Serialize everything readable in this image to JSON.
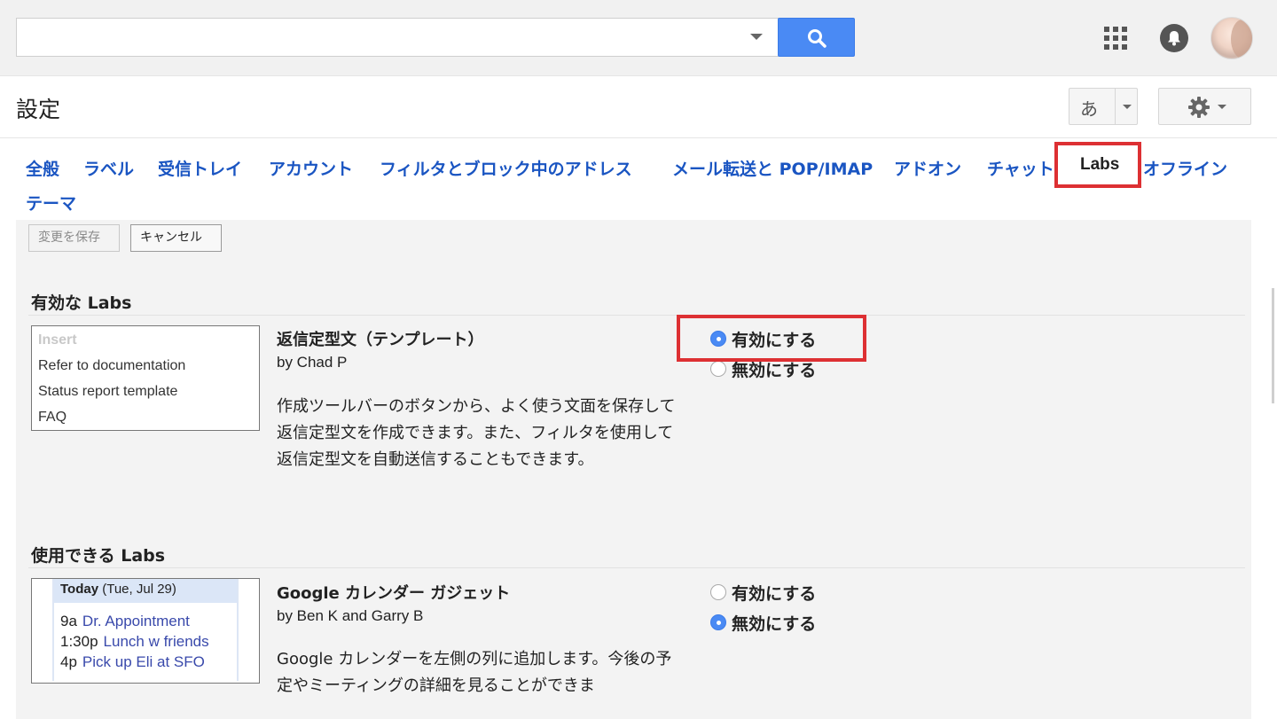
{
  "search": {
    "value": "",
    "placeholder": ""
  },
  "header": {
    "title": "設定",
    "ime_label": "あ"
  },
  "tabs": [
    {
      "label": "全般"
    },
    {
      "label": "ラベル"
    },
    {
      "label": "受信トレイ"
    },
    {
      "label": "アカウント"
    },
    {
      "label": "フィルタとブロック中のアドレス"
    },
    {
      "label": "メール転送と POP/IMAP"
    },
    {
      "label": "アドオン"
    },
    {
      "label": "チャット"
    },
    {
      "label": "Labs",
      "active": true
    },
    {
      "label": "オフライン"
    },
    {
      "label": "テーマ"
    }
  ],
  "actions": {
    "save_label": "変更を保存",
    "cancel_label": "キャンセル"
  },
  "enabled_labs": {
    "title": "有効な Labs",
    "items": [
      {
        "preview": [
          "Insert",
          "Refer to documentation",
          "Status report template",
          "FAQ"
        ],
        "title": "返信定型文（テンプレート）",
        "author": "by Chad P",
        "description": "作成ツールバーのボタンから、よく使う文面を保存して返信定型文を作成できます。また、フィルタを使用して返信定型文を自動送信することもできます。",
        "enable_label": "有効にする",
        "disable_label": "無効にする",
        "state": "enabled"
      }
    ]
  },
  "available_labs": {
    "title": "使用できる Labs",
    "items": [
      {
        "preview": {
          "today_label": "Today",
          "today_date": "(Tue, Jul 29)",
          "events": [
            {
              "time": "9a",
              "title": "Dr. Appointment"
            },
            {
              "time": "1:30p",
              "title": "Lunch w friends"
            },
            {
              "time": "4p",
              "title": "Pick up Eli at SFO"
            }
          ]
        },
        "title": "Google カレンダー ガジェット",
        "author": "by Ben K and Garry B",
        "description": "Google カレンダーを左側の列に追加します。今後の予定やミーティングの詳細を見ることができま",
        "enable_label": "有効にする",
        "disable_label": "無効にする",
        "state": "disabled"
      }
    ]
  },
  "colors": {
    "link": "#1a55c2",
    "accent": "#4a8af4",
    "highlight": "#dd3033"
  }
}
